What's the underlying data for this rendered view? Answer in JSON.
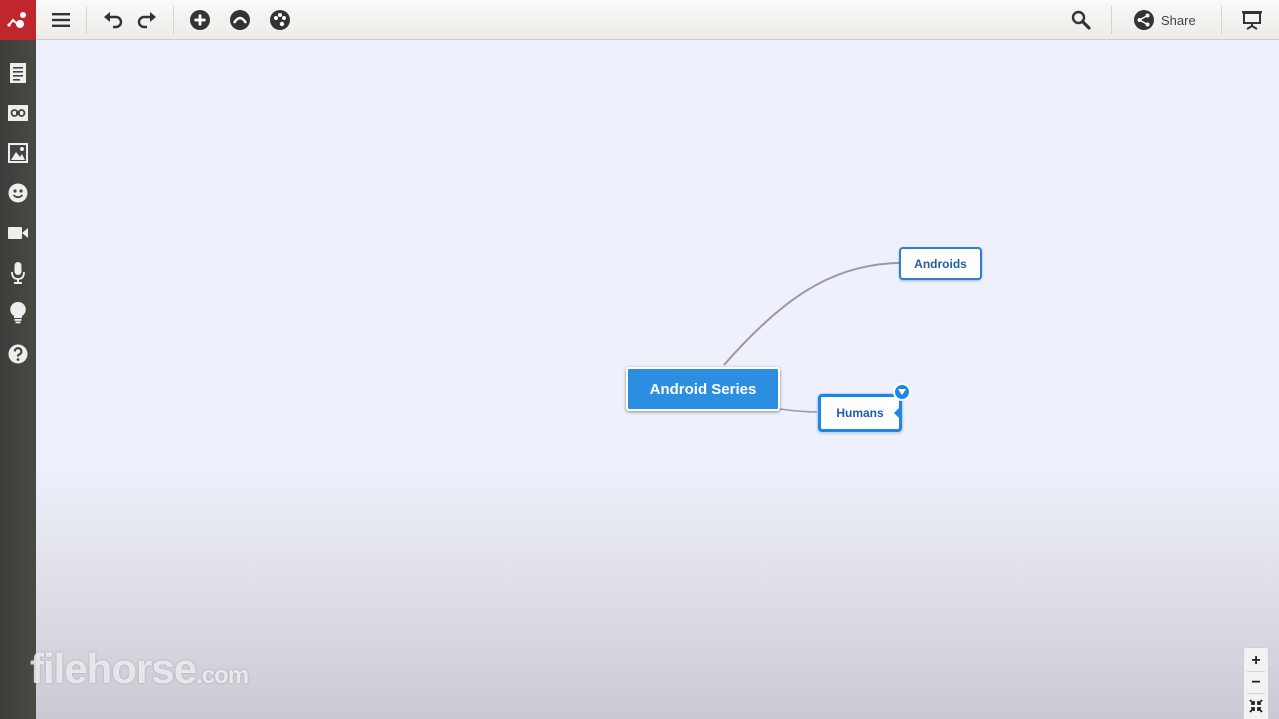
{
  "toolbar": {
    "share_label": "Share"
  },
  "mindmap": {
    "root": "Android Series",
    "children": [
      "Androids",
      "Humans"
    ],
    "selected": "Humans"
  },
  "watermark": {
    "main": "filehorse",
    "domain": ".com"
  },
  "zoom": {
    "in_label": "+",
    "out_label": "−"
  },
  "colors": {
    "brand": "#c0272d",
    "root_node": "#2b8ee0",
    "selection": "#1f86e6",
    "canvas": "#eef1fb"
  },
  "icons": {
    "toolbar": [
      "menu-icon",
      "undo-icon",
      "redo-icon",
      "add-node-icon",
      "style-icon",
      "palette-icon",
      "search-icon",
      "share-icon",
      "present-icon"
    ],
    "sidebar": [
      "notes-icon",
      "link-icon",
      "image-icon",
      "emoji-icon",
      "video-icon",
      "microphone-icon",
      "idea-icon",
      "help-icon"
    ]
  }
}
